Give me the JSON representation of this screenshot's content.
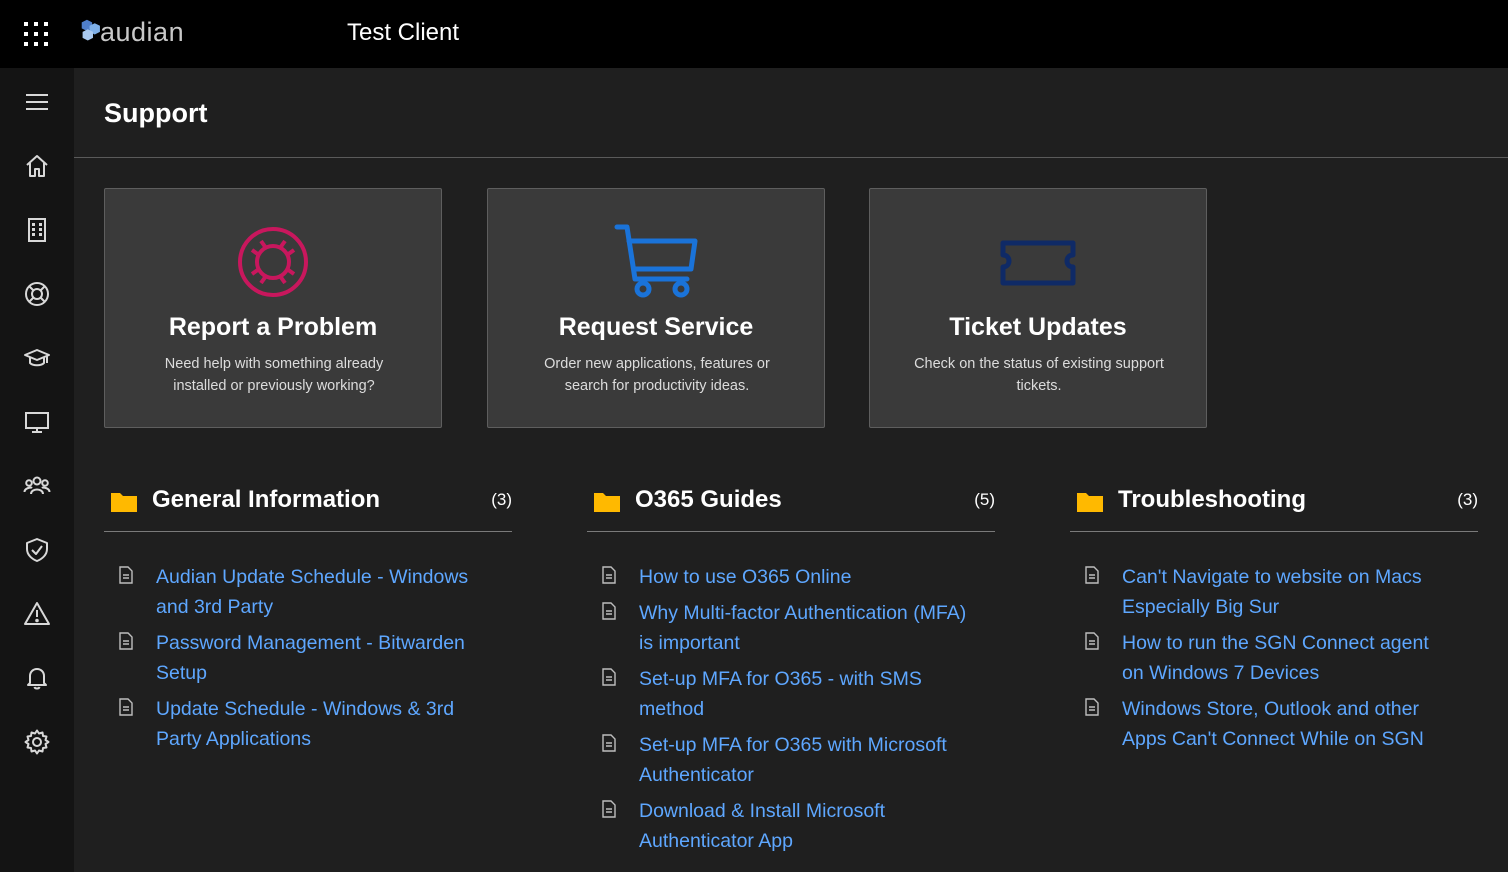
{
  "header": {
    "logo_text": "audian",
    "tenant_name": "Test Client"
  },
  "sidebar": {
    "items": [
      {
        "icon": "hamburger-menu-icon"
      },
      {
        "icon": "home-icon"
      },
      {
        "icon": "building-icon"
      },
      {
        "icon": "lifebuoy-icon"
      },
      {
        "icon": "graduation-cap-icon"
      },
      {
        "icon": "monitor-icon"
      },
      {
        "icon": "people-icon"
      },
      {
        "icon": "shield-check-icon"
      },
      {
        "icon": "warning-triangle-icon"
      },
      {
        "icon": "bell-icon"
      },
      {
        "icon": "gear-icon"
      }
    ]
  },
  "page": {
    "title": "Support"
  },
  "cards": [
    {
      "title": "Report a Problem",
      "description": "Need help with something already installed or previously working?",
      "icon": "lifebuoy-icon",
      "color": "#c8175d"
    },
    {
      "title": "Request Service",
      "description": "Order new applications, features or search for productivity ideas.",
      "icon": "shopping-cart-icon",
      "color": "#1a73d9"
    },
    {
      "title": "Ticket Updates",
      "description": "Check on the status of existing support tickets.",
      "icon": "ticket-icon",
      "color": "#0f2a66"
    }
  ],
  "categories": [
    {
      "title": "General Information",
      "count": "(3)",
      "articles": [
        "Audian Update Schedule - Windows and 3rd Party",
        "Password Management - Bitwarden Setup",
        "Update Schedule - Windows & 3rd Party Applications"
      ]
    },
    {
      "title": "O365 Guides",
      "count": "(5)",
      "articles": [
        "How to use O365 Online",
        "Why Multi-factor Authentication (MFA) is important",
        "Set-up MFA for O365 - with SMS method",
        "Set-up MFA for O365 with Microsoft Authenticator",
        "Download & Install Microsoft Authenticator App"
      ]
    },
    {
      "title": "Troubleshooting",
      "count": "(3)",
      "articles": [
        "Can't Navigate to website on Macs Especially Big Sur",
        "How to run the SGN Connect agent on Windows 7 Devices",
        "Windows Store, Outlook and other Apps Can't Connect While on SGN"
      ]
    }
  ],
  "colors": {
    "folder": "#ffb900",
    "link": "#5ea7ff",
    "topbar": "#000000",
    "sidebar": "#141414",
    "background": "#1f1f1f",
    "card": "#3a3a3a"
  }
}
